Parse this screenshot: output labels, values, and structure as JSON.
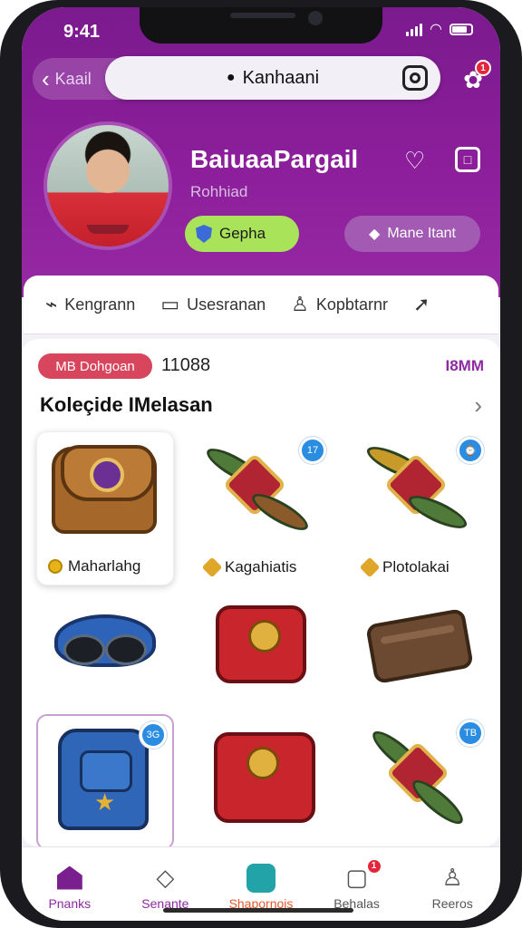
{
  "status": {
    "time": "9:41"
  },
  "topbar": {
    "back_label": "Kaail",
    "search_label": "Kanhaani",
    "notification_count": "1"
  },
  "profile": {
    "name": "BaiuaaPargail",
    "subtitle": "Rohhiad",
    "verified_label": "Gepha",
    "action_label": "Mane Itant"
  },
  "tabs": [
    {
      "label": "Kengrann",
      "icon": "share-icon"
    },
    {
      "label": "Usesranan",
      "icon": "bookmark-icon"
    },
    {
      "label": "Kopbtarnr",
      "icon": "user-icon"
    }
  ],
  "collection": {
    "tag": "MB Dohgoan",
    "count": "11088",
    "sort": "I8MM",
    "title": "Koleçide IMelasan",
    "items": [
      {
        "label": "Maharlahg",
        "badge": "",
        "art": "satchel"
      },
      {
        "label": "Kagahiatis",
        "badge": "17",
        "art": "ornament"
      },
      {
        "label": "Plotolakai",
        "badge": "⌚",
        "art": "ornament"
      },
      {
        "label": "",
        "badge": "",
        "art": "goggles"
      },
      {
        "label": "",
        "badge": "",
        "art": "redbag"
      },
      {
        "label": "",
        "badge": "",
        "art": "wallet"
      },
      {
        "label": "",
        "badge": "3G",
        "art": "bluepack"
      },
      {
        "label": "",
        "badge": "",
        "art": "redbag"
      },
      {
        "label": "",
        "badge": "TB",
        "art": "ornament"
      }
    ]
  },
  "nav": [
    {
      "label": "Pnanks",
      "icon": "home-icon"
    },
    {
      "label": "Senante",
      "icon": "tag-icon"
    },
    {
      "label": "Shapornois",
      "icon": "store-icon"
    },
    {
      "label": "Behalas",
      "icon": "inbox-icon",
      "badge": "1"
    },
    {
      "label": "Reeros",
      "icon": "profile-icon"
    }
  ],
  "colors": {
    "header": "#8e1f9c",
    "accent": "#8d2aa1",
    "green_pill": "#a9e35a",
    "tag_red": "#d8465d"
  }
}
